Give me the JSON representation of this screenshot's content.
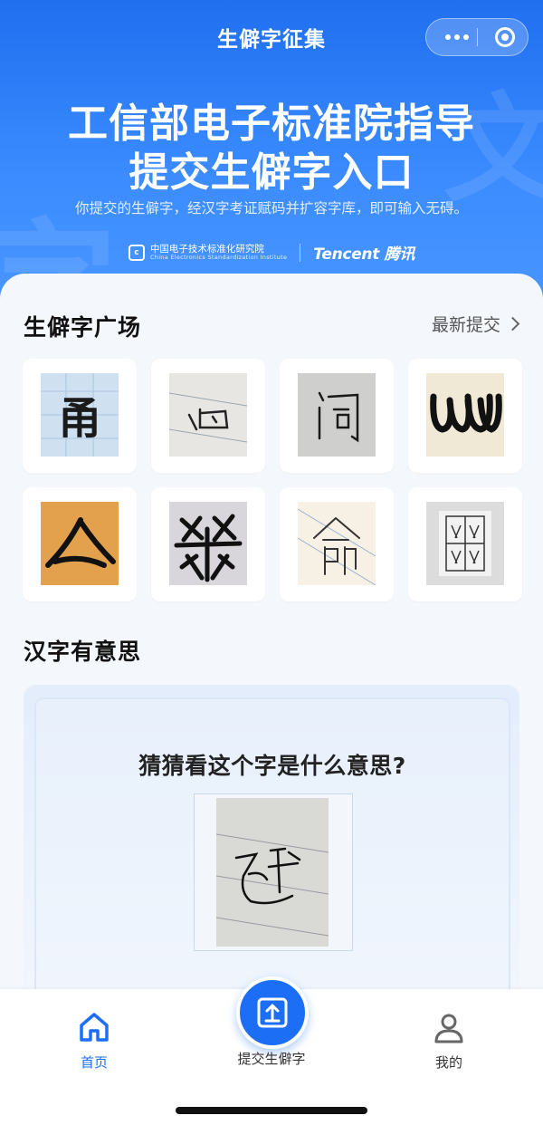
{
  "nav": {
    "title": "生僻字征集"
  },
  "hero": {
    "headline_1": "工信部电子标准院指导",
    "headline_2": "提交生僻字入口",
    "subtitle": "你提交的生僻字，经汉字考证赋码并扩容字库，即可输入无碍。",
    "cesi_cn": "中国电子技术标准化研究院",
    "cesi_en": "China Electronics Standardization Institute",
    "tencent": "Tencent 腾讯"
  },
  "plaza": {
    "title": "生僻字广场",
    "more": "最新提交",
    "tiles": [
      {
        "glyph": "𠮶",
        "ink": "#1a1a1a",
        "bg": "#cfe0f1"
      },
      {
        "glyph": "",
        "ink": "#222",
        "bg": "#e8e6e3"
      },
      {
        "glyph": "",
        "ink": "#222",
        "bg": "#cfcfcd"
      },
      {
        "glyph": "",
        "ink": "#111",
        "bg": "#efe9d6"
      },
      {
        "glyph": "",
        "ink": "#111",
        "bg": "#e3a04d"
      },
      {
        "glyph": "",
        "ink": "#111",
        "bg": "#d8d6da"
      },
      {
        "glyph": "",
        "ink": "#333",
        "bg": "#f7f0e4"
      },
      {
        "glyph": "",
        "ink": "#222",
        "bg": "#dcdcdc"
      }
    ]
  },
  "fun": {
    "title": "汉字有意思",
    "question": "猜猜看这个字是什么意思?"
  },
  "tabs": {
    "home": "首页",
    "submit": "提交生僻字",
    "mine": "我的"
  },
  "colors": {
    "accent": "#1c6ff5",
    "hero_top": "#1f6ff0"
  }
}
